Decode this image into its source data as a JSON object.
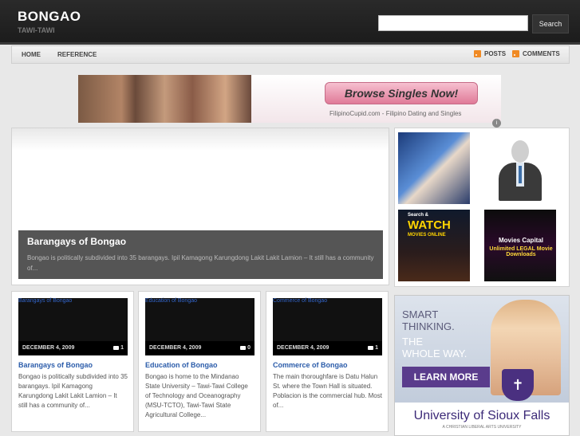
{
  "header": {
    "site_title": "BONGAO",
    "site_description": "TAWI-TAWI",
    "search_placeholder": "",
    "search_button": "Search"
  },
  "nav": {
    "items": [
      {
        "label": "HOME"
      },
      {
        "label": "REFERENCE"
      }
    ],
    "feeds": [
      {
        "label": "POSTS",
        "icon": "rss-icon"
      },
      {
        "label": "COMMENTS",
        "icon": "rss-icon"
      }
    ]
  },
  "ad_banner": {
    "button_text": "Browse Singles Now!",
    "brand_text": "FilipinoCupid.com - Filipino Dating and Singles"
  },
  "featured": {
    "title": "Barangays of Bongao",
    "excerpt": "Bongao is politically subdivided into 35 barangays. Ipil Kamagong Karungdong Lakit Lakit Lamion – It still has a community of..."
  },
  "side_ads": {
    "watch": {
      "top": "Search &",
      "headline": "WATCH",
      "sub": "MOVIES ONLINE"
    },
    "movies": {
      "title": "Movies Capital",
      "subtitle": "Unlimited LEGAL Movie Downloads"
    }
  },
  "posts": [
    {
      "link_text": "Barangays of Bongao",
      "date": "DECEMBER 4, 2009",
      "comments": "1",
      "title": "Barangays of Bongao",
      "excerpt": "Bongao is politically subdivided into 35 barangays. Ipil Kamagong Karungdong Lakit Lakit Lamion – It still has a community of..."
    },
    {
      "link_text": "Education of Bongao",
      "date": "DECEMBER 4, 2009",
      "comments": "0",
      "title": "Education of Bongao",
      "excerpt": "Bongao is home to the Mindanao State University – Tawi-Tawi College of Technology and Oceanography (MSU-TCTO), Tawi-Tawi State Agricultural College..."
    },
    {
      "link_text": "Commerce of Bongao",
      "date": "DECEMBER 4, 2009",
      "comments": "1",
      "title": "Commerce of Bongao",
      "excerpt": "The main thoroughfare is Datu Halun St. where the Town Hall is situated. Poblacion is the commercial hub. Most of..."
    }
  ],
  "usf_ad": {
    "line1": "SMART",
    "line2": "THINKING.",
    "line3": "THE",
    "line4": "WHOLE WAY.",
    "button": "LEARN MORE",
    "name": "University of Sioux Falls",
    "tagline": "A CHRISTIAN LIBERAL ARTS UNIVERSITY"
  }
}
